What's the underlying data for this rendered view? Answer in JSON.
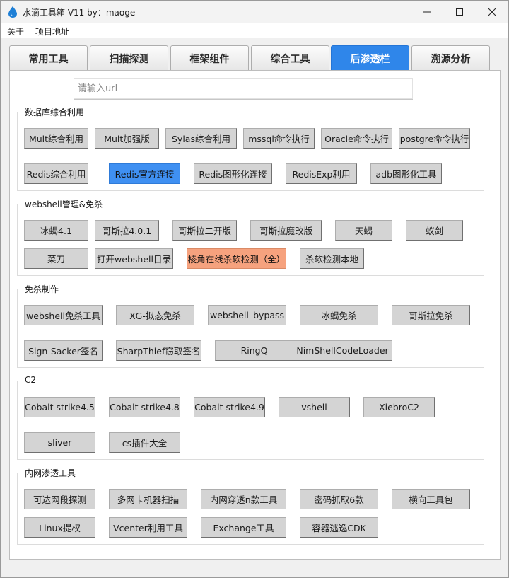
{
  "window": {
    "title": "水滴工具箱 V11 by：maoge",
    "icon": "water-drop-icon",
    "accent_color": "#2f86ea"
  },
  "menu": [
    "关于",
    "项目地址"
  ],
  "tabs": [
    "常用工具",
    "扫描探测",
    "框架组件",
    "综合工具",
    "后渗透栏",
    "溯源分析"
  ],
  "active_tab": "后渗透栏",
  "url_input": {
    "placeholder": "请输入url",
    "value": ""
  },
  "groups": [
    {
      "title": "数据库综合利用",
      "rows": [
        [
          "Mult综合利用",
          "Mult加强版",
          "Sylas综合利用",
          "mssql命令执行",
          "Oracle命令执行",
          "postgre命令执行"
        ],
        [
          "Redis综合利用",
          "Redis官方连接",
          "Redis图形化连接",
          "RedisExp利用",
          "adb图形化工具"
        ]
      ]
    },
    {
      "title": "webshell管理&免杀",
      "rows": [
        [
          "冰蝎4.1",
          "哥斯拉4.0.1",
          "哥斯拉二开版",
          "哥斯拉魔改版",
          "天蝎",
          "蚁剑"
        ],
        [
          "菜刀",
          "打开webshell目录",
          "棱角在线杀软检测（全）",
          "杀软检测本地"
        ]
      ]
    },
    {
      "title": "免杀制作",
      "rows": [
        [
          "webshell免杀工具",
          "XG-拟态免杀",
          "webshell_bypass",
          "冰蝎免杀",
          "哥斯拉免杀"
        ],
        [
          "Sign-Sacker签名",
          "SharpThief窃取签名",
          "RingQ",
          "NimShellCodeLoader"
        ]
      ]
    },
    {
      "title": "C2",
      "rows": [
        [
          "Cobalt strike4.5",
          "Cobalt strike4.8",
          "Cobalt strike4.9",
          "vshell",
          "XiebroC2"
        ],
        [
          "sliver",
          "cs插件大全"
        ]
      ]
    },
    {
      "title": "内网渗透工具",
      "rows": [
        [
          "可达网段探测",
          "多网卡机器扫描",
          "内网穿透n款工具",
          "密码抓取6款",
          "横向工具包"
        ],
        [
          "Linux提权",
          "Vcenter利用工具",
          "Exchange工具",
          "容器逃逸CDK"
        ]
      ]
    }
  ],
  "highlighted_buttons": {
    "Redis官方连接": "#3f90f2",
    "棱角在线杀软检测（全）": "#f6a27e"
  }
}
